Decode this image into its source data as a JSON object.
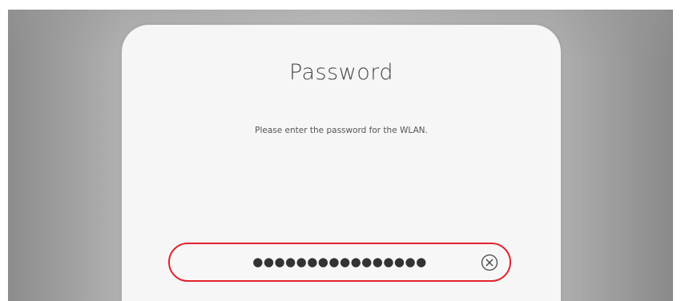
{
  "dialog": {
    "title": "Password",
    "message": "Please enter the password for the WLAN.",
    "password_field": {
      "masked_value": "●●●●●●●●●●●●●●●●",
      "focused": true
    },
    "clear_icon": "clear-circle-x-icon"
  },
  "colors": {
    "accent": "#e0232f",
    "dialog_background": "#f6f6f6",
    "backdrop": "#b3b3b3"
  }
}
